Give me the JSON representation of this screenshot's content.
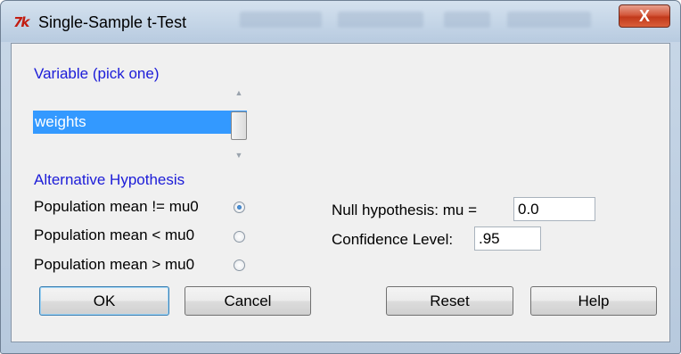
{
  "window": {
    "title": "Single-Sample t-Test",
    "app_icon_text": "7k",
    "close_glyph": "X"
  },
  "variable_section": {
    "heading": "Variable (pick one)",
    "items": [
      "weights"
    ],
    "selected": "weights"
  },
  "alternative_section": {
    "heading": "Alternative Hypothesis",
    "options": [
      {
        "label": "Population mean != mu0",
        "checked": true
      },
      {
        "label": "Population mean < mu0",
        "checked": false
      },
      {
        "label": "Population mean > mu0",
        "checked": false
      }
    ]
  },
  "null_hypothesis": {
    "label": "Null hypothesis: mu =",
    "value": "0.0"
  },
  "confidence": {
    "label": "Confidence Level:",
    "value": ".95"
  },
  "buttons": {
    "ok": "OK",
    "cancel": "Cancel",
    "reset": "Reset",
    "help": "Help"
  },
  "colors": {
    "accent_blue": "#1c1cd8",
    "selection": "#3399ff",
    "close_red": "#c2391b"
  }
}
